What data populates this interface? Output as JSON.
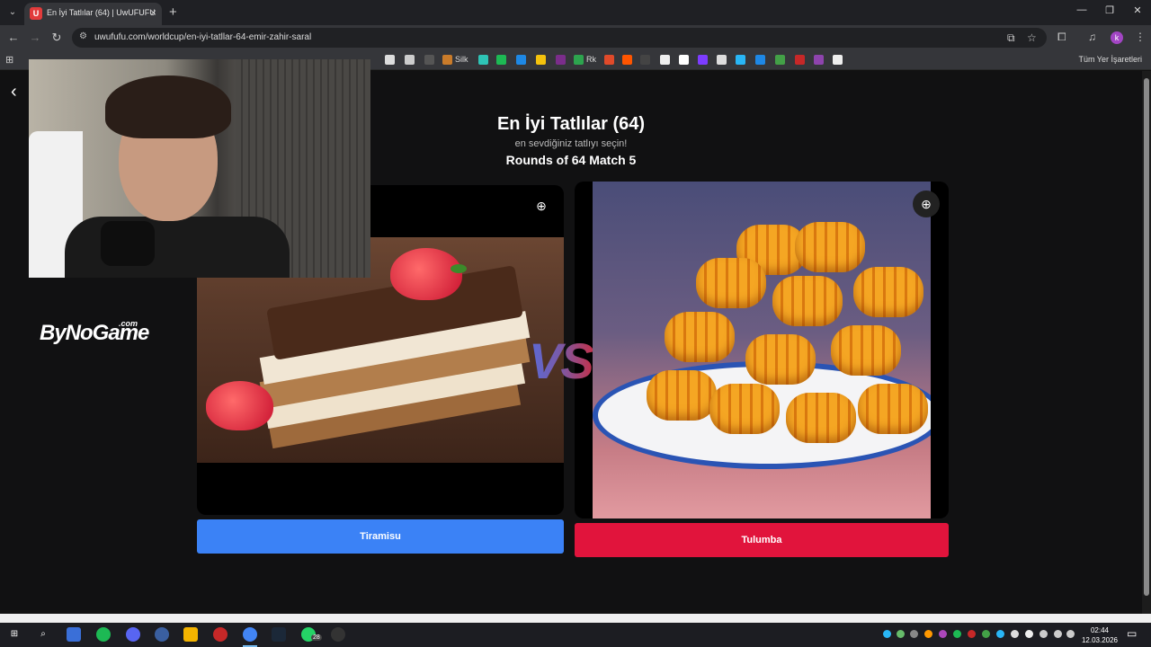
{
  "browser": {
    "tab_title": "En İyi Tatlılar (64) | UwUFUFU",
    "tab_favicon": "U",
    "url": "uwufufu.com/worldcup/en-iyi-tatllar-64-emir-zahir-saral",
    "bookmark_silk": "Silk",
    "bookmark_rk": "Rk",
    "all_bookmarks": "Tüm Yer İşaretleri",
    "profile_initial": "k"
  },
  "page": {
    "title": "En İyi Tatlılar (64)",
    "subtitle": "en sevdiğiniz tatlıyı seçin!",
    "round": "Rounds of 64 Match 5",
    "vs": "VS",
    "left_choice": "Tiramisu",
    "right_choice": "Tulumba",
    "logo_main": "ByNoGame",
    "logo_com": ".com"
  },
  "taskbar": {
    "time": "02:44",
    "date": "12.03.2026",
    "whatsapp_badge": "28"
  },
  "colors": {
    "left_button": "#3b82f6",
    "right_button": "#e1143c",
    "background": "#111112"
  }
}
